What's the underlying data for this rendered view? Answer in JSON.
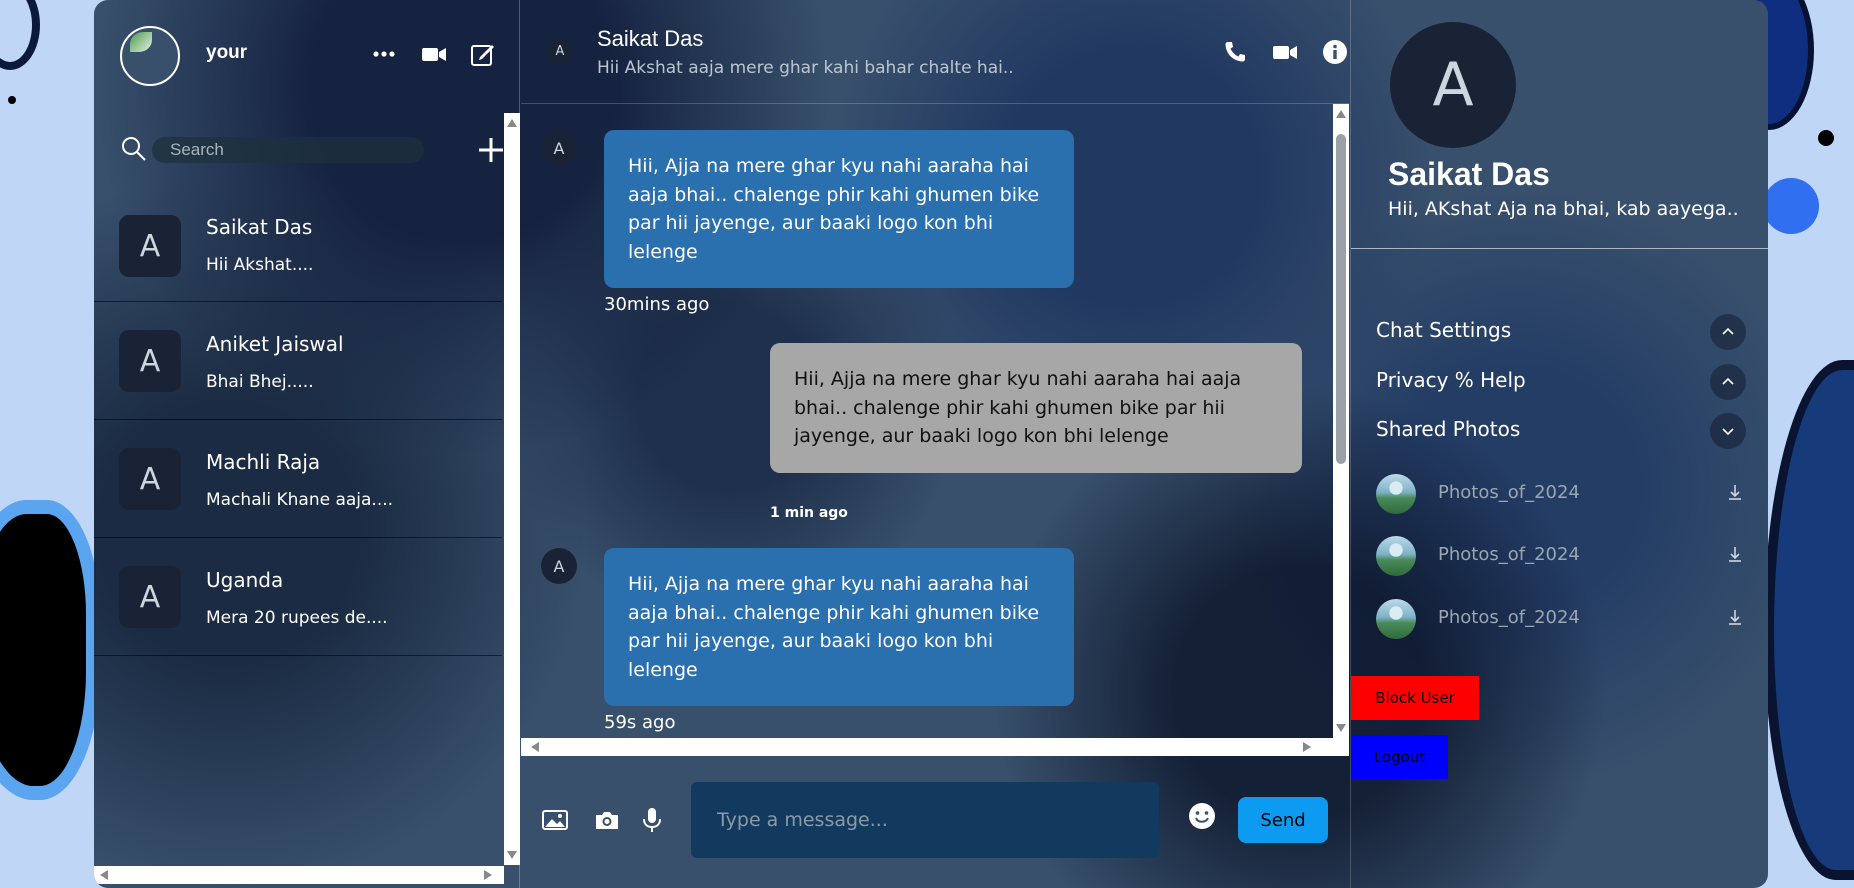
{
  "sidebar": {
    "username": "your",
    "search_placeholder": "Search",
    "conversations": [
      {
        "initial": "A",
        "name": "Saikat Das",
        "preview": "Hii Akshat...."
      },
      {
        "initial": "A",
        "name": "Aniket Jaiswal",
        "preview": "Bhai Bhej....."
      },
      {
        "initial": "A",
        "name": "Machli Raja",
        "preview": "Machali Khane aaja...."
      },
      {
        "initial": "A",
        "name": "Uganda",
        "preview": "Mera 20 rupees de...."
      }
    ],
    "icons": [
      "more-icon",
      "video-icon",
      "compose-icon",
      "search-icon",
      "plus-icon"
    ]
  },
  "chat": {
    "header": {
      "initial": "A",
      "name": "Saikat Das",
      "status": "Hii Akshat aaja mere ghar kahi bahar chalte hai.."
    },
    "messages": [
      {
        "direction": "in",
        "initial": "A",
        "text": "Hii, Ajja na mere ghar kyu nahi aaraha hai aaja bhai.. chalenge phir kahi ghumen bike par hii jayenge, aur baaki logo kon bhi lelenge",
        "time": "30mins ago"
      },
      {
        "direction": "out",
        "text": "Hii, Ajja na mere ghar kyu nahi aaraha hai aaja bhai.. chalenge phir kahi ghumen bike par hii jayenge, aur baaki logo kon bhi lelenge",
        "time": "1 min ago"
      },
      {
        "direction": "in",
        "initial": "A",
        "text": "Hii, Ajja na mere ghar kyu nahi aaraha hai aaja bhai.. chalenge phir kahi ghumen bike par hii jayenge, aur baaki logo kon bhi lelenge",
        "time": "59s ago"
      }
    ],
    "composer": {
      "placeholder": "Type a message...",
      "send_label": "Send"
    }
  },
  "details": {
    "initial": "A",
    "name": "Saikat Das",
    "status": "Hii, AKshat Aja na bhai, kab aayega..",
    "options": [
      {
        "label": "Chat Settings",
        "state": "collapsed-up"
      },
      {
        "label": "Privacy % Help",
        "state": "collapsed-up"
      },
      {
        "label": "Shared Photos",
        "state": "expanded"
      }
    ],
    "photos": [
      "Photos_of_2024",
      "Photos_of_2024",
      "Photos_of_2024"
    ],
    "block_label": "Block User",
    "logout_label": "Logout"
  },
  "colors": {
    "incoming_bubble": "#2a6fae",
    "outgoing_bubble": "#a7a7a7",
    "send_button": "#0d9bf2",
    "block_button": "#ff0000",
    "logout_button": "#0000ff",
    "input_bg": "#123a5f"
  }
}
